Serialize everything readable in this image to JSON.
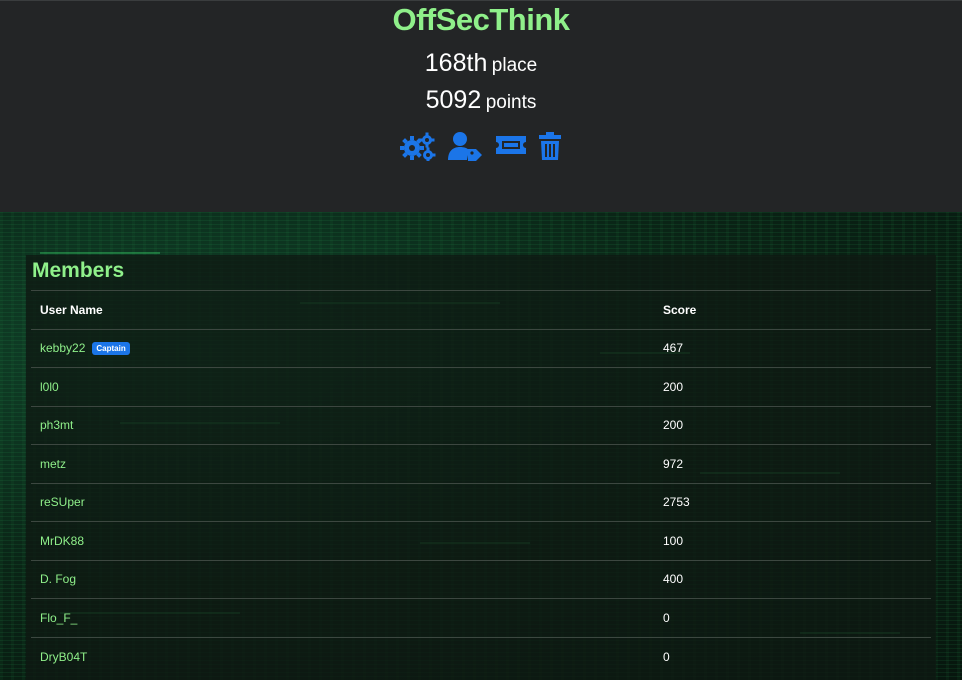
{
  "team": {
    "name": "OffSecThink",
    "place_number": "168th",
    "place_label": "place",
    "points_number": "5092",
    "points_label": "points"
  },
  "actions": [
    {
      "icon": "gears-icon",
      "label": "settings"
    },
    {
      "icon": "user-tag-icon",
      "label": "captain"
    },
    {
      "icon": "ticket-icon",
      "label": "invite"
    },
    {
      "icon": "trash-icon",
      "label": "delete"
    }
  ],
  "members": {
    "title": "Members",
    "columns": [
      "User Name",
      "Score"
    ],
    "rows": [
      {
        "name": "kebby22",
        "badge": "Captain",
        "score": "467"
      },
      {
        "name": "l0l0",
        "badge": "",
        "score": "200"
      },
      {
        "name": "ph3mt",
        "badge": "",
        "score": "200"
      },
      {
        "name": "metz",
        "badge": "",
        "score": "972"
      },
      {
        "name": "reSUper",
        "badge": "",
        "score": "2753"
      },
      {
        "name": "MrDK88",
        "badge": "",
        "score": "100"
      },
      {
        "name": "D. Fog",
        "badge": "",
        "score": "400"
      },
      {
        "name": "Flo_F_",
        "badge": "",
        "score": "0"
      },
      {
        "name": "DryB04T",
        "badge": "",
        "score": "0"
      }
    ]
  },
  "colors": {
    "accent_green": "#8ff08a",
    "icon_blue": "#1b75e8",
    "header_bg": "#232526"
  }
}
